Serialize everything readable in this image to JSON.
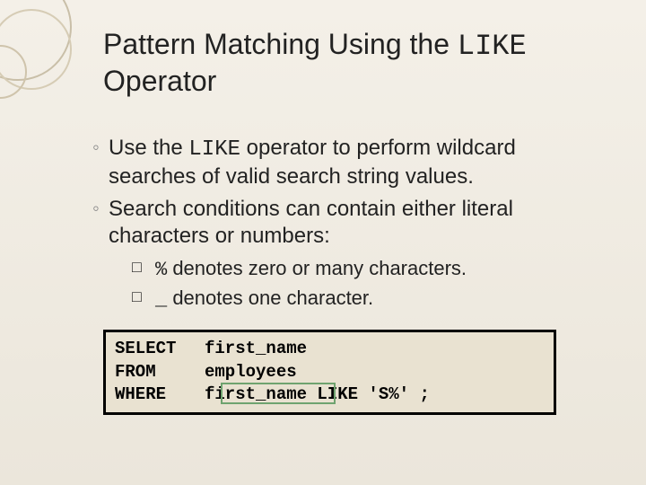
{
  "title": {
    "prefix": "Pattern Matching Using the ",
    "code": "LIKE",
    "suffix": " Operator"
  },
  "bullets": [
    {
      "prefix": "Use the ",
      "code": "LIKE",
      "suffix": " operator to perform wildcard searches of valid search string values."
    },
    {
      "text": "Search conditions can contain either literal characters or numbers:"
    }
  ],
  "subbullets": [
    {
      "code": "%",
      "text": " denotes zero or many characters."
    },
    {
      "code": "_",
      "text": " denotes one character."
    }
  ],
  "sql": {
    "lines": [
      {
        "kw": "SELECT",
        "rest": "first_name"
      },
      {
        "kw": "FROM",
        "rest": "employees"
      },
      {
        "kw": "WHERE",
        "rest": "first_name LIKE 'S%' ;"
      }
    ]
  }
}
